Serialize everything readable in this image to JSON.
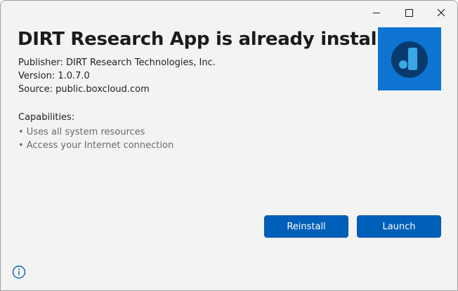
{
  "window": {
    "minimize_icon": "minimize-icon",
    "maximize_icon": "maximize-icon",
    "close_icon": "close-icon"
  },
  "install": {
    "title": "DIRT Research App is already installed",
    "publisher": "Publisher: DIRT Research Technologies, Inc.",
    "version": "Version: 1.0.7.0",
    "source": "Source: public.boxcloud.com",
    "app_icon": "app-logo-icon",
    "tile_color": "#0d74d1"
  },
  "capabilities": {
    "heading": "Capabilities:",
    "items": [
      "• Uses all system resources",
      "• Access your Internet connection"
    ]
  },
  "actions": {
    "reinstall_label": "Reinstall",
    "launch_label": "Launch",
    "accent_color": "#005fb8"
  },
  "footer": {
    "info_icon": "info-icon"
  }
}
